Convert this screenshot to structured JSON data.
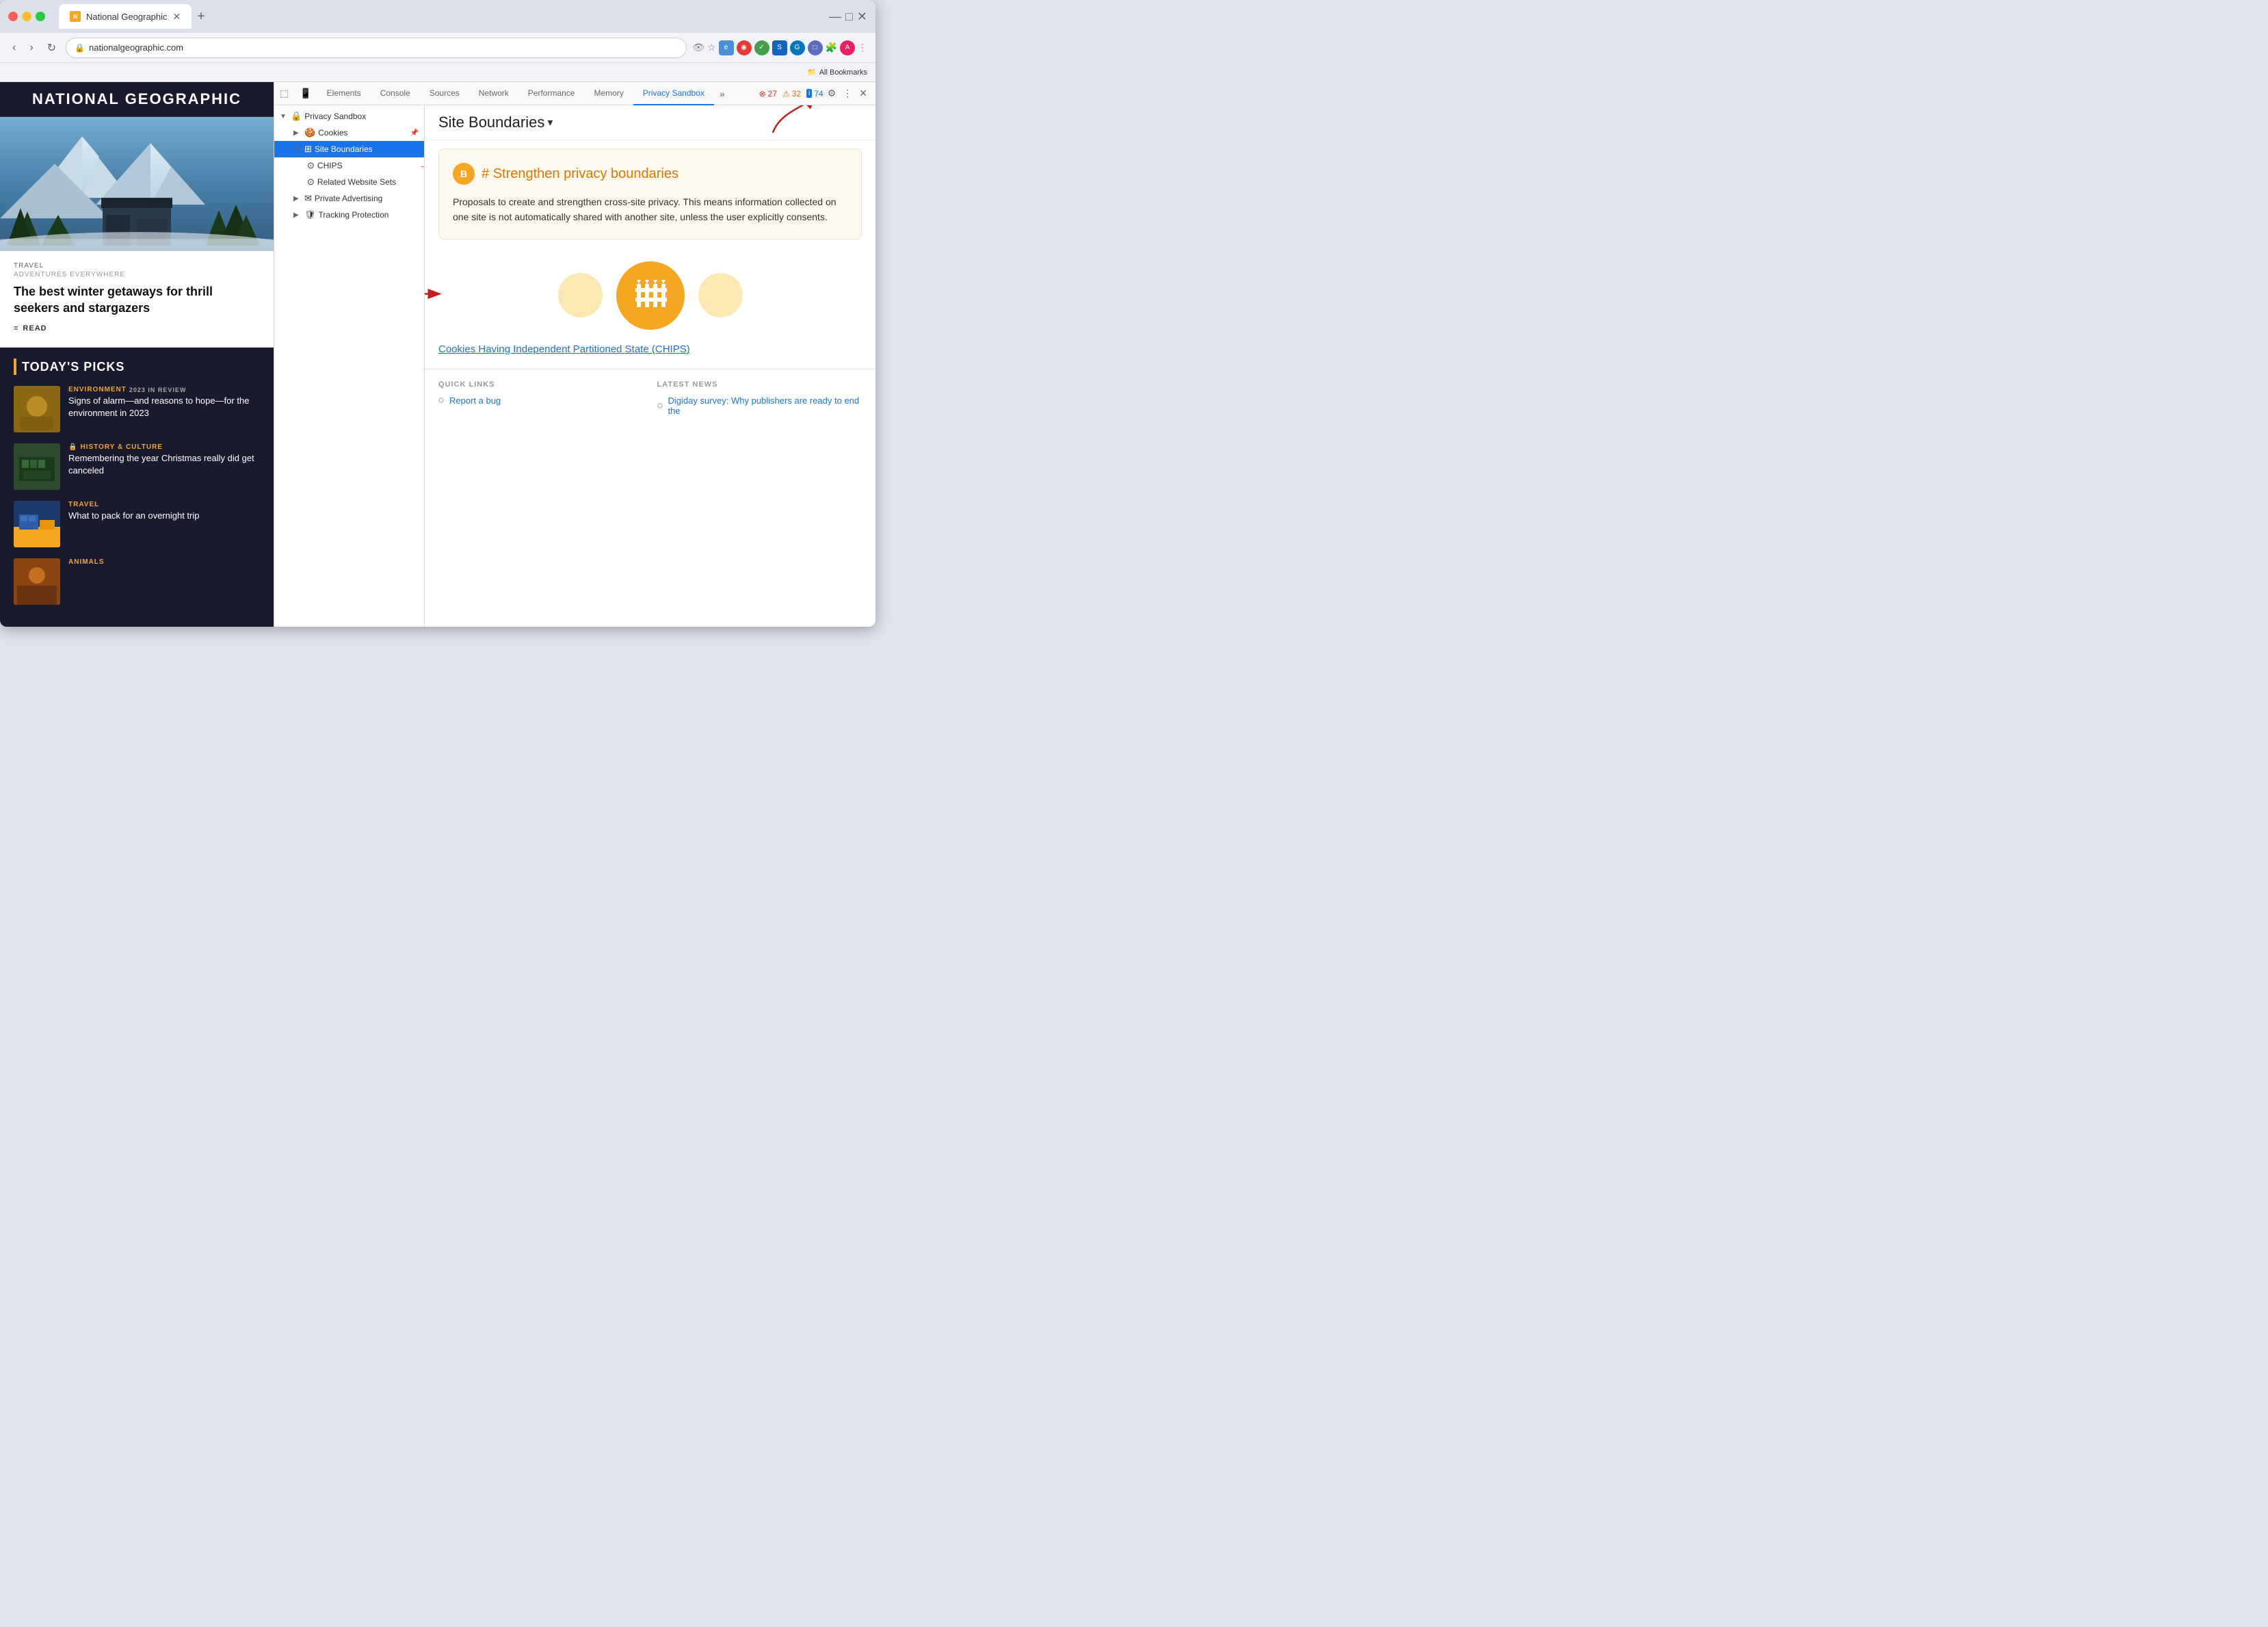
{
  "browser": {
    "tab_title": "National Geographic",
    "tab_favicon_text": "N",
    "address": "nationalgeographic.com",
    "bookmarks_bar_text": "All Bookmarks"
  },
  "devtools": {
    "tabs": [
      "Elements",
      "Console",
      "Sources",
      "Network",
      "Performance",
      "Memory",
      "Privacy Sandbox"
    ],
    "active_tab": "Privacy Sandbox",
    "more_tabs_icon": "»",
    "error_count": "27",
    "warning_count": "32",
    "info_count": "74",
    "tree": {
      "root": "Privacy Sandbox",
      "items": [
        {
          "label": "Cookies",
          "indent": 1,
          "expandable": true
        },
        {
          "label": "Site Boundaries",
          "indent": 1,
          "expandable": true,
          "selected": true
        },
        {
          "label": "CHIPS",
          "indent": 2
        },
        {
          "label": "Related Website Sets",
          "indent": 2
        },
        {
          "label": "Private Advertising",
          "indent": 1,
          "expandable": true
        },
        {
          "label": "Tracking Protection",
          "indent": 1,
          "expandable": true
        }
      ]
    },
    "main_panel": {
      "title": "Site Boundaries",
      "title_dropdown": "▾",
      "card": {
        "icon_text": "B",
        "title_hash": "#",
        "title": "Strengthen privacy boundaries",
        "description": "Proposals to create and strengthen cross-site privacy. This means information collected on one site is not automatically shared with another site, unless the user explicitly consents."
      },
      "chips_link": "Cookies Having Independent Partitioned State (CHIPS)",
      "quick_links_title": "QUICK LINKS",
      "latest_news_title": "LATEST NEWS",
      "quick_links": [
        {
          "text": "Report a bug"
        }
      ],
      "latest_news": [
        {
          "text": "Digiday survey: Why publishers are ready to end the"
        }
      ]
    }
  },
  "website": {
    "logo": "National Geographic",
    "hero": {
      "tag": "TRAVEL",
      "subtitle": "ADVENTURES EVERYWHERE",
      "title": "The best winter getaways for thrill seekers and stargazers",
      "read_label": "READ"
    },
    "section_title": "TODAY'S PICKS",
    "picks": [
      {
        "tag": "ENVIRONMENT",
        "tag2": "2023 IN REVIEW",
        "title": "Signs of alarm—and reasons to hope—for the environment in 2023",
        "thumb": "env"
      },
      {
        "tag": "HISTORY & CULTURE",
        "icon": "🔒",
        "title": "Remembering the year Christmas really did get canceled",
        "thumb": "hist"
      },
      {
        "tag": "TRAVEL",
        "title": "What to pack for an overnight trip",
        "thumb": "travel"
      },
      {
        "tag": "ANIMALS",
        "title": "",
        "thumb": "animals"
      }
    ]
  }
}
